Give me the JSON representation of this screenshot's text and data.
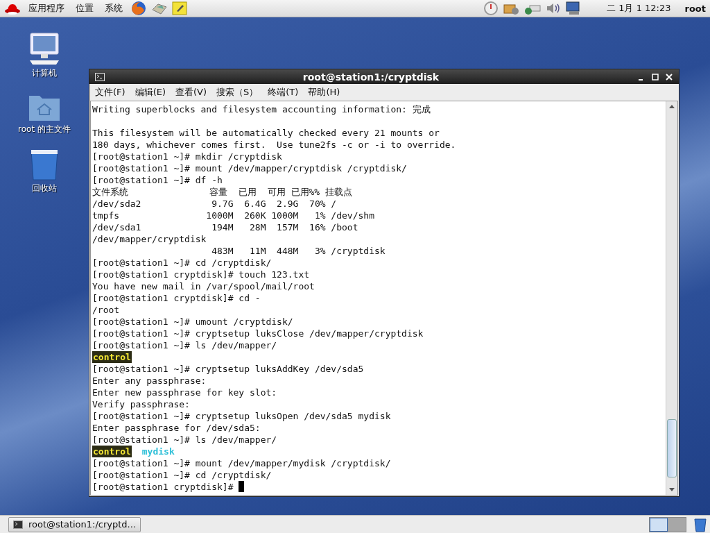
{
  "top_panel": {
    "menus": [
      "应用程序",
      "位置",
      "系统"
    ],
    "clock": "二  1月  1 12:23",
    "user": "root"
  },
  "desktop_icons": [
    {
      "kind": "computer",
      "label": "计算机"
    },
    {
      "kind": "home",
      "label": "root 的主文件"
    },
    {
      "kind": "trash",
      "label": "回收站"
    }
  ],
  "terminal": {
    "title": "root@station1:/cryptdisk",
    "menu": [
      "文件(F)",
      "编辑(E)",
      "查看(V)",
      "搜索（S）",
      "终端(T)",
      "帮助(H)"
    ],
    "blocks": [
      {
        "lines": [
          {
            "segments": [
              {
                "kind": "plain",
                "text": "Writing superblocks and filesystem accounting information: 完成"
              }
            ]
          }
        ]
      },
      {
        "lines": [
          {
            "segments": [
              {
                "kind": "plain",
                "text": "This filesystem will be automatically checked every 21 mounts or"
              }
            ]
          },
          {
            "segments": [
              {
                "kind": "plain",
                "text": "180 days, whichever comes first.  Use tune2fs -c or -i to override."
              }
            ]
          },
          {
            "segments": [
              {
                "kind": "plain",
                "text": "[root@station1 ~]# mkdir /cryptdisk"
              }
            ]
          },
          {
            "segments": [
              {
                "kind": "plain",
                "text": "[root@station1 ~]# mount /dev/mapper/cryptdisk /cryptdisk/"
              }
            ]
          },
          {
            "segments": [
              {
                "kind": "plain",
                "text": "[root@station1 ~]# df -h"
              }
            ]
          },
          {
            "segments": [
              {
                "kind": "plain",
                "text": "文件系统               容量  已用  可用 已用%% 挂载点"
              }
            ]
          },
          {
            "segments": [
              {
                "kind": "plain",
                "text": "/dev/sda2             9.7G  6.4G  2.9G  70% /"
              }
            ]
          },
          {
            "segments": [
              {
                "kind": "plain",
                "text": "tmpfs                1000M  260K 1000M   1% /dev/shm"
              }
            ]
          },
          {
            "segments": [
              {
                "kind": "plain",
                "text": "/dev/sda1             194M   28M  157M  16% /boot"
              }
            ]
          },
          {
            "segments": [
              {
                "kind": "plain",
                "text": "/dev/mapper/cryptdisk"
              }
            ]
          },
          {
            "segments": [
              {
                "kind": "plain",
                "text": "                      483M   11M  448M   3% /cryptdisk"
              }
            ]
          },
          {
            "segments": [
              {
                "kind": "plain",
                "text": "[root@station1 ~]# cd /cryptdisk/"
              }
            ]
          },
          {
            "segments": [
              {
                "kind": "plain",
                "text": "[root@station1 cryptdisk]# touch 123.txt"
              }
            ]
          },
          {
            "segments": [
              {
                "kind": "plain",
                "text": "You have new mail in /var/spool/mail/root"
              }
            ]
          },
          {
            "segments": [
              {
                "kind": "plain",
                "text": "[root@station1 cryptdisk]# cd -"
              }
            ]
          },
          {
            "segments": [
              {
                "kind": "plain",
                "text": "/root"
              }
            ]
          },
          {
            "segments": [
              {
                "kind": "plain",
                "text": "[root@station1 ~]# umount /cryptdisk/"
              }
            ]
          },
          {
            "segments": [
              {
                "kind": "plain",
                "text": "[root@station1 ~]# cryptsetup luksClose /dev/mapper/cryptdisk"
              }
            ]
          },
          {
            "segments": [
              {
                "kind": "plain",
                "text": "[root@station1 ~]# ls /dev/mapper/"
              }
            ]
          },
          {
            "segments": [
              {
                "kind": "highlight",
                "text": "control"
              }
            ]
          },
          {
            "segments": [
              {
                "kind": "plain",
                "text": "[root@station1 ~]# cryptsetup luksAddKey /dev/sda5"
              }
            ]
          },
          {
            "segments": [
              {
                "kind": "plain",
                "text": "Enter any passphrase:"
              }
            ]
          },
          {
            "segments": [
              {
                "kind": "plain",
                "text": "Enter new passphrase for key slot:"
              }
            ]
          },
          {
            "segments": [
              {
                "kind": "plain",
                "text": "Verify passphrase:"
              }
            ]
          },
          {
            "segments": [
              {
                "kind": "plain",
                "text": "[root@station1 ~]# cryptsetup luksOpen /dev/sda5 mydisk"
              }
            ]
          },
          {
            "segments": [
              {
                "kind": "plain",
                "text": "Enter passphrase for /dev/sda5:"
              }
            ]
          },
          {
            "segments": [
              {
                "kind": "plain",
                "text": "[root@station1 ~]# ls /dev/mapper/"
              }
            ]
          },
          {
            "segments": [
              {
                "kind": "highlight",
                "text": "control"
              },
              {
                "kind": "cyan",
                "text": "mydisk"
              }
            ]
          },
          {
            "segments": [
              {
                "kind": "plain",
                "text": "[root@station1 ~]# mount /dev/mapper/mydisk /cryptdisk/"
              }
            ]
          },
          {
            "segments": [
              {
                "kind": "plain",
                "text": "[root@station1 ~]# cd /cryptdisk/"
              }
            ]
          },
          {
            "segments": [
              {
                "kind": "plain",
                "text": "[root@station1 cryptdisk]# "
              }
            ],
            "cursor": true
          }
        ]
      }
    ]
  },
  "taskbar": {
    "task": "root@station1:/cryptd...",
    "workspaces": [
      {
        "selected": true
      },
      {
        "selected": false
      }
    ]
  }
}
